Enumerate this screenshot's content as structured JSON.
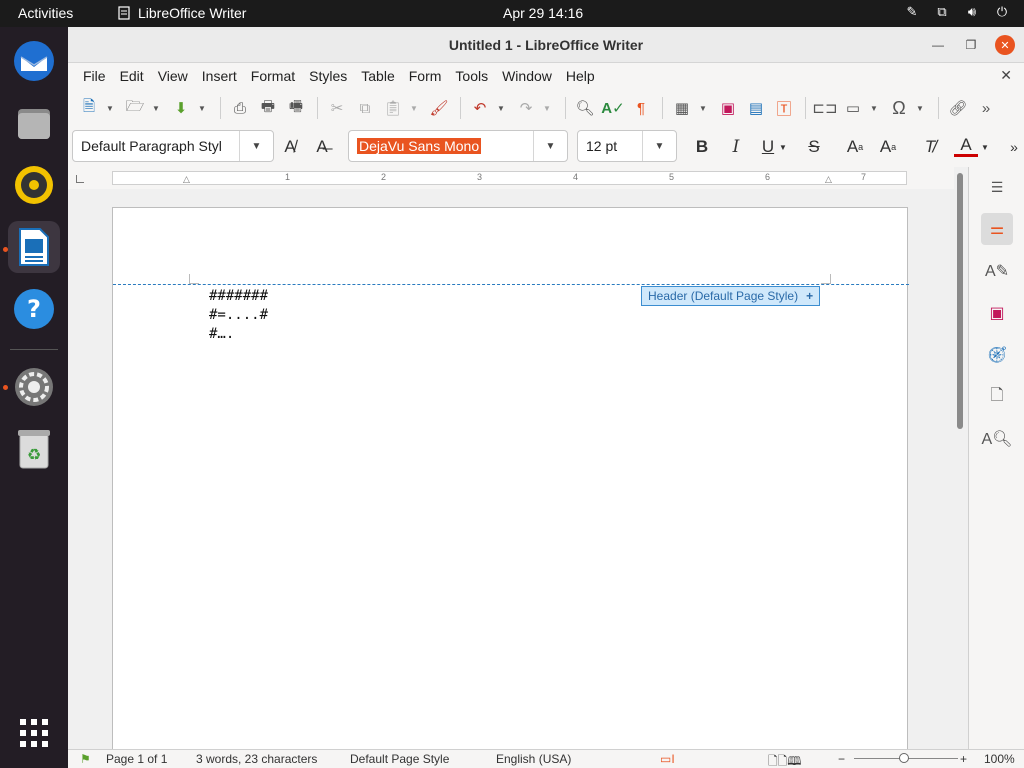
{
  "topbar": {
    "activities": "Activities",
    "app_name": "LibreOffice Writer",
    "clock": "Apr 29  14:16"
  },
  "dock": {
    "items": [
      "thunderbird-icon",
      "files-icon",
      "rhythmbox-icon",
      "writer-icon",
      "help-icon",
      "settings-icon",
      "trash-icon",
      "app-grid-icon"
    ]
  },
  "window": {
    "title": "Untitled 1 - LibreOffice Writer"
  },
  "menu": {
    "items": [
      "File",
      "Edit",
      "View",
      "Insert",
      "Format",
      "Styles",
      "Table",
      "Form",
      "Tools",
      "Window",
      "Help"
    ]
  },
  "formatting": {
    "paragraph_style": "Default Paragraph Styl",
    "font_name": "DejaVu Sans Mono",
    "font_size": "12 pt"
  },
  "ruler": {
    "numbers": [
      "1",
      "2",
      "3",
      "4",
      "5",
      "6",
      "7"
    ]
  },
  "document": {
    "header_label": "Header (Default Page Style)",
    "header_plus": "+",
    "lines": [
      "#######",
      "#=....#",
      "#…."
    ]
  },
  "status": {
    "page": "Page 1 of 1",
    "words": "3 words, 23 characters",
    "page_style": "Default Page Style",
    "language": "English (USA)",
    "zoom": "100%"
  },
  "colors": {
    "accent": "#e95420",
    "header_border": "#3b8dd0"
  }
}
